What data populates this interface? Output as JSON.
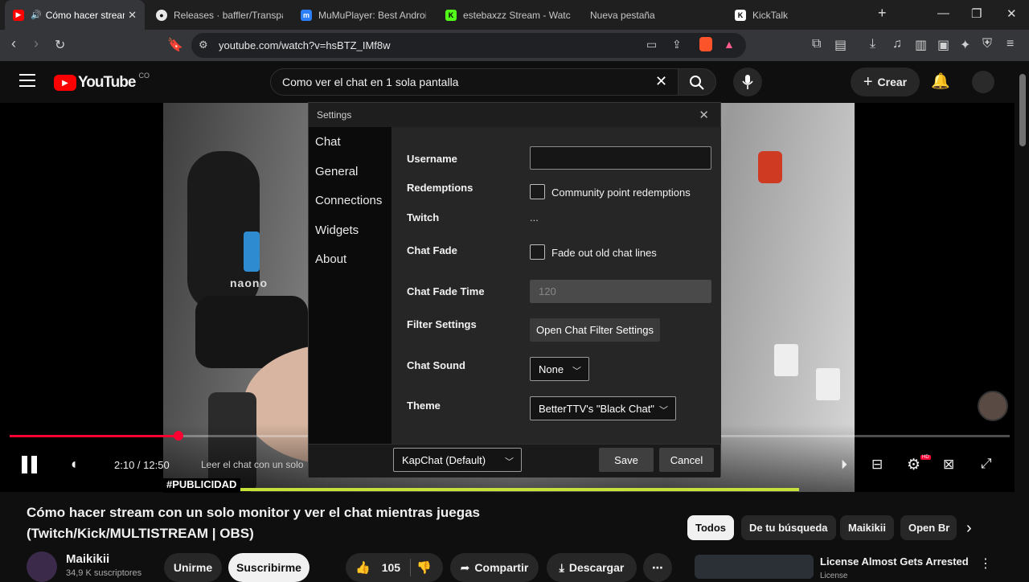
{
  "tabs": [
    {
      "title": "Cómo hacer stream",
      "favicon": "youtube-icon",
      "color": "#ff0000",
      "active": true
    },
    {
      "title": "Releases · baffler/Transpar",
      "favicon": "github-icon",
      "color": "#e8e8e8"
    },
    {
      "title": "MuMuPlayer: Best Android",
      "favicon": "mumu-icon",
      "color": "#2d7ff9"
    },
    {
      "title": "estebaxzz Stream - Watch",
      "favicon": "kick-icon",
      "color": "#53fc18"
    },
    {
      "title": "Nueva pestaña",
      "favicon": "none"
    },
    {
      "title": "KickTalk",
      "favicon": "kicktalk-icon",
      "color": "#ffffff"
    }
  ],
  "address_bar": {
    "url": "youtube.com/watch?v=hsBTZ_IMf8w"
  },
  "youtube": {
    "logo_text": "YouTube",
    "country_code": "CO",
    "search_query": "Como ver el chat en 1 sola pantalla",
    "create_label": "Crear"
  },
  "settings": {
    "window_title": "Settings",
    "nav": [
      "Chat",
      "General",
      "Connections",
      "Widgets",
      "About"
    ],
    "labels": {
      "username": "Username",
      "redemptions": "Redemptions",
      "twitch": "Twitch",
      "chat_fade": "Chat Fade",
      "chat_fade_time": "Chat Fade Time",
      "filter_settings": "Filter Settings",
      "chat_sound": "Chat Sound",
      "theme": "Theme"
    },
    "username_value": "",
    "redemptions_checkbox": "Community point redemptions",
    "twitch_value": "...",
    "chat_fade_checkbox": "Fade out old chat lines",
    "chat_fade_time_value": "120",
    "filter_button": "Open Chat Filter Settings",
    "chat_sound_value": "None",
    "theme_value": "BetterTTV's \"Black Chat\"",
    "preset_value": "KapChat (Default)",
    "save_label": "Save",
    "cancel_label": "Cancel"
  },
  "player": {
    "time": "2:10 / 12:50",
    "chapter": "Leer el chat con un solo",
    "ad_tag": "#PUBLICIDAD",
    "progress_fraction": 0.1688,
    "naono_label": "naono",
    "hd_badge": "HD"
  },
  "video": {
    "title": "Cómo hacer stream con un solo monitor y ver el chat mientras juegas (Twitch/Kick/MULTISTREAM | OBS)",
    "channel": "Maikikii",
    "subscribers": "34,9 K suscriptores",
    "join_label": "Unirme",
    "subscribe_label": "Suscribirme",
    "likes": "105",
    "share_label": "Compartir",
    "download_label": "Descargar"
  },
  "chips": [
    "Todos",
    "De tu búsqueda",
    "Maikikii",
    "Open Br"
  ],
  "recommendation": {
    "title": "License Almost Gets Arrested",
    "subtitle": "License"
  }
}
